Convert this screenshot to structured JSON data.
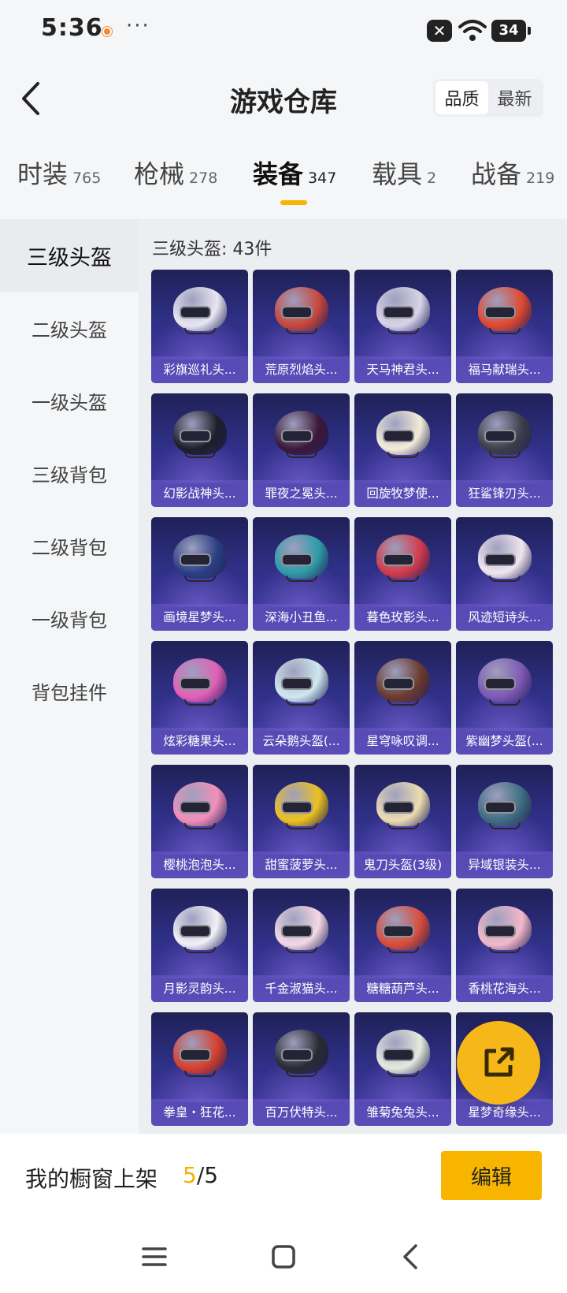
{
  "status": {
    "time": "5:36",
    "more": "···",
    "battery": "34"
  },
  "header": {
    "title": "游戏仓库",
    "sort_options": [
      "品质",
      "最新"
    ]
  },
  "tabs": [
    {
      "label": "时装",
      "count": "765"
    },
    {
      "label": "枪械",
      "count": "278"
    },
    {
      "label": "装备",
      "count": "347"
    },
    {
      "label": "载具",
      "count": "2"
    },
    {
      "label": "战备",
      "count": "219"
    }
  ],
  "sidebar": [
    "三级头盔",
    "二级头盔",
    "一级头盔",
    "三级背包",
    "二级背包",
    "一级背包",
    "背包挂件"
  ],
  "content": {
    "count_label": "三级头盔: 43件",
    "items": [
      {
        "name": "彩旗巡礼头...",
        "color": "#e8e6f2"
      },
      {
        "name": "荒原烈焰头...",
        "color": "#c8473a"
      },
      {
        "name": "天马神君头...",
        "color": "#d8d4e6"
      },
      {
        "name": "福马献瑞头...",
        "color": "#e0492e"
      },
      {
        "name": "幻影战神头...",
        "color": "#1e1e28"
      },
      {
        "name": "罪夜之冕头...",
        "color": "#3b1838"
      },
      {
        "name": "回旋牧梦使...",
        "color": "#f3ecd8"
      },
      {
        "name": "狂鲨锋刃头...",
        "color": "#3c3e48"
      },
      {
        "name": "画境星梦头...",
        "color": "#2a3f82"
      },
      {
        "name": "深海小丑鱼...",
        "color": "#2e9ca6"
      },
      {
        "name": "暮色玫影头...",
        "color": "#d23a4a"
      },
      {
        "name": "风迹短诗头...",
        "color": "#f0e6ee"
      },
      {
        "name": "炫彩糖果头...",
        "color": "#e25fb6"
      },
      {
        "name": "云朵鹅头盔(...",
        "color": "#cfe8ee"
      },
      {
        "name": "星穹咏叹调...",
        "color": "#6c3a2e"
      },
      {
        "name": "紫幽梦头盔(...",
        "color": "#7d58b4"
      },
      {
        "name": "樱桃泡泡头...",
        "color": "#f28fb8"
      },
      {
        "name": "甜蜜菠萝头...",
        "color": "#ecc11e"
      },
      {
        "name": "鬼刀头盔(3级)",
        "color": "#eddcb0"
      },
      {
        "name": "异域银装头...",
        "color": "#3e6d80"
      },
      {
        "name": "月影灵韵头...",
        "color": "#f2f0f6"
      },
      {
        "name": "千金淑猫头...",
        "color": "#f4d8e4"
      },
      {
        "name": "糖糖葫芦头...",
        "color": "#d94d3c"
      },
      {
        "name": "香桃花海头...",
        "color": "#f3b8c8"
      },
      {
        "name": "拳皇・狂花...",
        "color": "#d6402e"
      },
      {
        "name": "百万伏特头...",
        "color": "#2a2a32"
      },
      {
        "name": "雏菊兔兔头...",
        "color": "#e4eadc"
      },
      {
        "name": "星梦奇缘头...",
        "color": "#8a78c8"
      }
    ]
  },
  "bottom": {
    "shelf_label": "我的橱窗上架",
    "shelf_current": "5",
    "shelf_total": "/5",
    "edit_label": "编辑"
  },
  "accent_color": "#f7b500"
}
